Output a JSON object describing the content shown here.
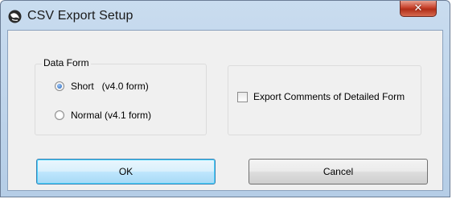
{
  "window": {
    "title": "CSV Export Setup",
    "close_glyph": "✕"
  },
  "data_form": {
    "legend": "Data Form",
    "options": [
      {
        "label": "Short   (v4.0 form)",
        "checked": true
      },
      {
        "label": "Normal (v4.1 form)",
        "checked": false
      }
    ]
  },
  "export_comments": {
    "label": "Export Comments of Detailed Form",
    "checked": false
  },
  "buttons": {
    "ok": "OK",
    "cancel": "Cancel"
  },
  "icons": {
    "app": "app-globe-icon",
    "close": "close-icon"
  },
  "colors": {
    "titlebar": "#bcd2e8",
    "client": "#f0f0f0",
    "close_button": "#c7412b",
    "default_button_border": "#3c7fb1"
  }
}
